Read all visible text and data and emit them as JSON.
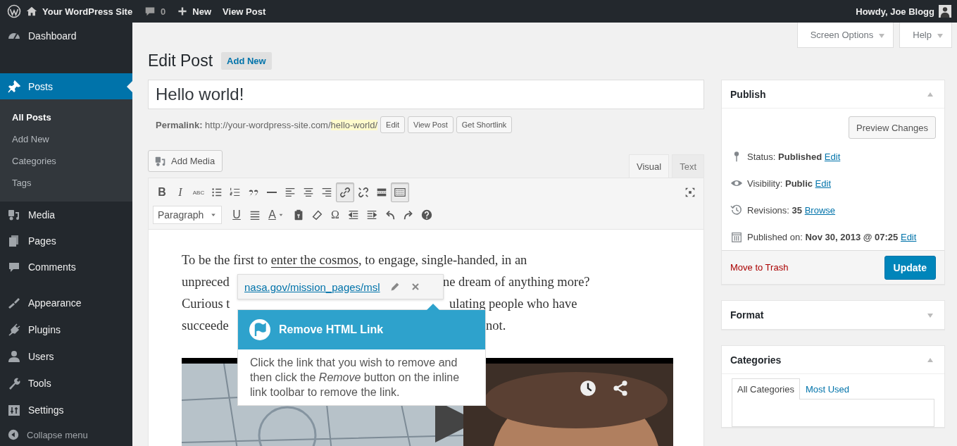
{
  "admin_bar": {
    "site": "Your WordPress Site",
    "comments": "0",
    "new": "New",
    "view_post": "View Post",
    "greeting": "Howdy, Joe Blogg"
  },
  "sidebar": {
    "items": [
      {
        "label": "Dashboard",
        "selected": false
      },
      {
        "label": "Posts",
        "selected": true,
        "children": [
          {
            "label": "All Posts",
            "selected": true
          },
          {
            "label": "Add New",
            "selected": false
          },
          {
            "label": "Categories",
            "selected": false
          },
          {
            "label": "Tags",
            "selected": false
          }
        ]
      },
      {
        "label": "Media",
        "selected": false
      },
      {
        "label": "Pages",
        "selected": false
      },
      {
        "label": "Comments",
        "selected": false
      },
      {
        "label": "Appearance",
        "selected": false
      },
      {
        "label": "Plugins",
        "selected": false
      },
      {
        "label": "Users",
        "selected": false
      },
      {
        "label": "Tools",
        "selected": false
      },
      {
        "label": "Settings",
        "selected": false
      }
    ],
    "collapse": "Collapse menu"
  },
  "screen_options": "Screen Options",
  "help": "Help",
  "heading": "Edit Post",
  "add_new": "Add New",
  "title_value": "Hello world!",
  "permalink": {
    "label": "Permalink:",
    "base": "http://your-wordpress-site.com/",
    "slug": "hello-world/",
    "buttons": [
      "Edit",
      "View Post",
      "Get Shortlink"
    ]
  },
  "add_media": "Add Media",
  "editor_tabs": [
    {
      "label": "Visual",
      "selected": true
    },
    {
      "label": "Text",
      "selected": false
    }
  ],
  "toolbar": {
    "format": "Paragraph",
    "rows": [
      [
        {
          "glyph": "B",
          "pressed": false
        },
        {
          "glyph": "I",
          "pressed": false
        },
        {
          "glyph": "ABC",
          "pressed": false
        },
        {
          "pressed": false
        },
        {
          "pressed": false
        },
        {
          "pressed": false
        },
        {
          "pressed": false
        },
        {
          "pressed": false
        },
        {
          "pressed": false
        },
        {
          "pressed": false
        },
        {
          "pressed": true
        },
        {
          "pressed": false
        },
        {
          "pressed": false
        },
        {
          "pressed": true
        },
        {
          "pressed": false
        }
      ],
      [
        {
          "glyph": "U",
          "pressed": false
        },
        {
          "pressed": false
        },
        {
          "glyph": "A",
          "pressed": false
        },
        {
          "pressed": false
        },
        {
          "pressed": false
        },
        {
          "glyph": "Ω",
          "pressed": false
        },
        {
          "pressed": false
        },
        {
          "pressed": false
        },
        {
          "pressed": false
        },
        {
          "pressed": false
        },
        {
          "pressed": false
        }
      ]
    ]
  },
  "content": {
    "lines": [
      {
        "before": "To be the first to ",
        "link": "enter the cosmos",
        "after": ", to engage, single-handed, in an"
      },
      {
        "left": "unpreced",
        "right": "ne dream of anything more?"
      },
      {
        "left": "Curious t",
        "right": "ulating people who have"
      },
      {
        "left": "succeede",
        "right": "not."
      }
    ]
  },
  "link_toolbar": {
    "url": "nasa.gov/mission_pages/msl"
  },
  "tooltip": {
    "title": "Remove HTML Link",
    "body": "Click the link that you wish to remove and then click the *Remove* button on the inline link toolbar to remove the link."
  },
  "publish": {
    "title": "Publish",
    "expanded": true,
    "preview": "Preview Changes",
    "rows": [
      {
        "label": "Status:",
        "value": "Published",
        "link": "Edit"
      },
      {
        "label": "Visibility:",
        "value": "Public",
        "link": "Edit"
      },
      {
        "label": "Revisions:",
        "value": "35",
        "link": "Browse"
      },
      {
        "label": "Published on:",
        "value": "Nov 30, 2013 @ 07:25",
        "link": "Edit"
      }
    ],
    "trash": "Move to Trash",
    "update": "Update"
  },
  "format_box": {
    "title": "Format",
    "expanded": false
  },
  "categories_box": {
    "title": "Categories",
    "expanded": true,
    "tabs": [
      {
        "label": "All Categories",
        "selected": true
      },
      {
        "label": "Most Used",
        "selected": false
      }
    ]
  }
}
